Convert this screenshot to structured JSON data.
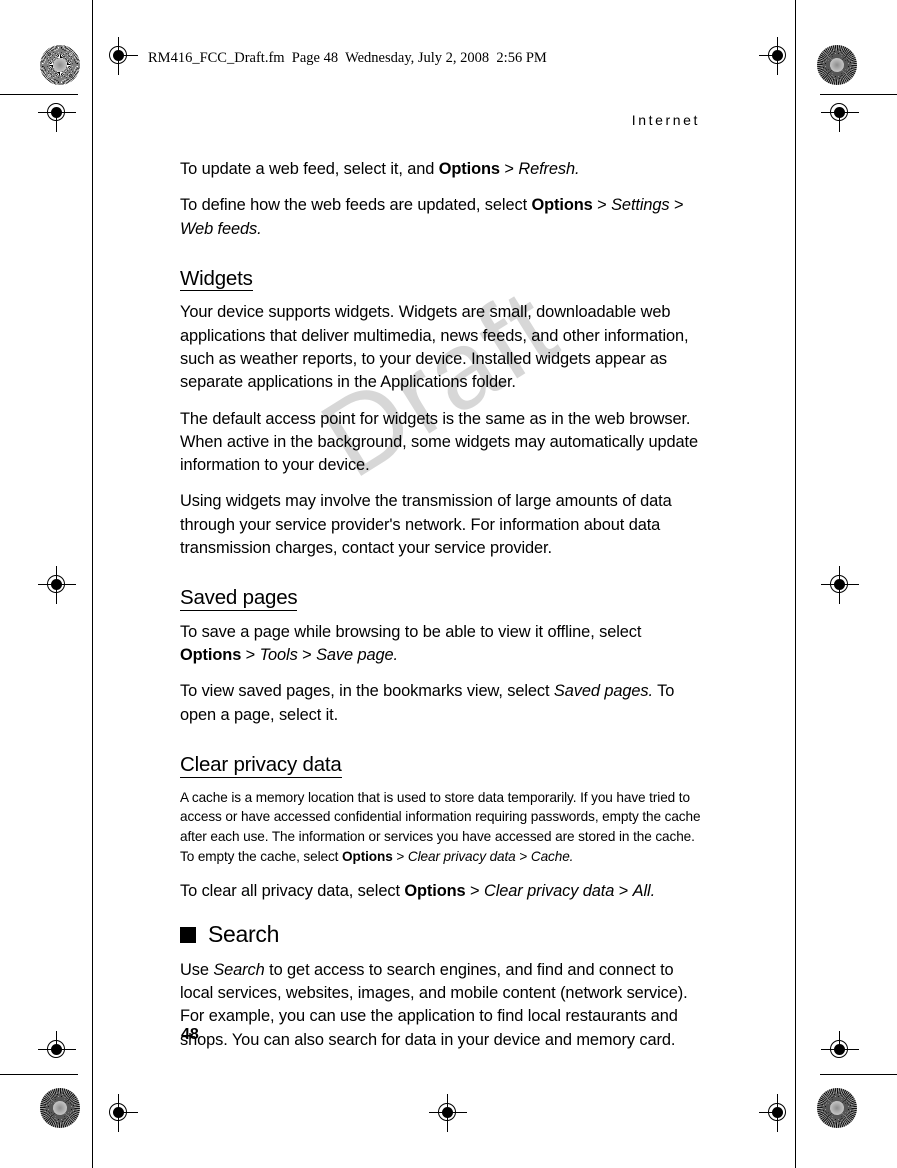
{
  "document": {
    "slug": "RM416_FCC_Draft.fm  Page 48  Wednesday, July 2, 2008  2:56 PM",
    "running_head": "Internet",
    "watermark": "Draft",
    "folio": "48"
  },
  "body": {
    "para_update_feed": {
      "t1": "To update a web feed, select it, and ",
      "b1": "Options",
      "gt1": " > ",
      "i1": "Refresh."
    },
    "para_define_feeds": {
      "t1": "To define how the web feeds are updated, select ",
      "b1": "Options",
      "gt1": " > ",
      "i1": "Settings",
      "gt2": " > ",
      "i2": "Web feeds."
    },
    "heading_widgets": "Widgets",
    "para_widgets_1": "Your device supports widgets. Widgets are small, downloadable web applications that deliver multimedia, news feeds, and other information, such as weather reports, to your device. Installed widgets appear as separate applications in the Applications folder.",
    "para_widgets_2": "The default access point for widgets is the same as in the web browser. When active in the background, some widgets may automatically update information to your device.",
    "para_widgets_3": "Using widgets may involve the transmission of large amounts of data through your service provider's network. For information about data transmission charges, contact your service provider.",
    "heading_saved_pages": "Saved pages",
    "para_saved_1": {
      "t1": "To save a page while browsing to be able to view it offline, select ",
      "b1": "Options",
      "gt1": " > ",
      "i1": "Tools",
      "gt2": " > ",
      "i2": "Save page."
    },
    "para_saved_2": {
      "t1": "To view saved pages, in the bookmarks view, select ",
      "i1": "Saved pages.",
      "t2": " To open a page, select it."
    },
    "heading_clear_privacy": "Clear privacy data",
    "para_cache": {
      "t1": "A cache is a memory location that is used to store data temporarily. If you have tried to access or have accessed confidential information requiring passwords, empty the cache after each use. The information or services you have accessed are stored in the cache. To empty the cache, select ",
      "b1": "Options",
      "gt1": " > ",
      "i1": "Clear privacy data",
      "gt2": " > ",
      "i2": "Cache."
    },
    "para_clear_all": {
      "t1": "To clear all privacy data, select ",
      "b1": "Options",
      "gt1": " > ",
      "i1": "Clear privacy data",
      "gt2": " > ",
      "i2": "All."
    },
    "heading_search": "Search",
    "para_search": {
      "t1": "Use ",
      "i1": "Search",
      "t2": " to get access to search engines, and find and connect to local services, websites, images, and mobile content (network service). For example, you can use the application to find local restaurants and shops. You can also search for data in your device and memory card."
    }
  }
}
